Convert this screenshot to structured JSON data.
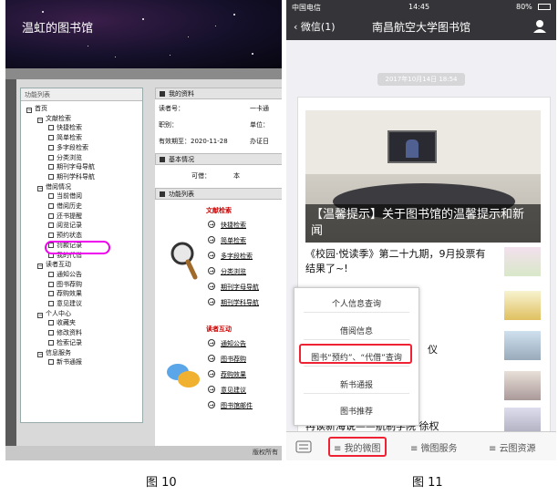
{
  "left": {
    "banner_title": "温虹的图书馆",
    "tree_header": "功能列表",
    "tree": [
      {
        "label": "首页",
        "level": 0
      },
      {
        "label": "文献检索",
        "level": 1
      },
      {
        "label": "快捷检索",
        "level": 2
      },
      {
        "label": "简单检索",
        "level": 2
      },
      {
        "label": "多字段检索",
        "level": 2
      },
      {
        "label": "分类浏览",
        "level": 2
      },
      {
        "label": "期刊字母导航",
        "level": 2
      },
      {
        "label": "期刊学科导航",
        "level": 2
      },
      {
        "label": "借阅情况",
        "level": 1
      },
      {
        "label": "当前借阅",
        "level": 2
      },
      {
        "label": "借阅历史",
        "level": 2
      },
      {
        "label": "还书提醒",
        "level": 2
      },
      {
        "label": "阅览记录",
        "level": 2
      },
      {
        "label": "预约状态",
        "level": 2
      },
      {
        "label": "罚款记录",
        "level": 2
      },
      {
        "label": "我的代借",
        "level": 2
      },
      {
        "label": "读者互动",
        "level": 1
      },
      {
        "label": "通知公告",
        "level": 2
      },
      {
        "label": "图书荐购",
        "level": 2
      },
      {
        "label": "荐购效果",
        "level": 2
      },
      {
        "label": "意见建议",
        "level": 2
      },
      {
        "label": "个人中心",
        "level": 1
      },
      {
        "label": "收藏夹",
        "level": 2
      },
      {
        "label": "修改资料",
        "level": 2
      },
      {
        "label": "检索记录",
        "level": 2
      },
      {
        "label": "信息服务",
        "level": 1
      },
      {
        "label": "新书通报",
        "level": 2
      }
    ],
    "info_header": "我的资料",
    "info_lines": [
      "读者号：",
      "一卡通",
      "职别：",
      "单位：",
      "有效期至：2020-11-28",
      "办证日"
    ],
    "basic_header": "基本情况",
    "basic_line": "可借：",
    "basic_value": "本",
    "func_header": "功能列表",
    "sec1_title": "文献检索",
    "sec1_links": [
      "快捷检索",
      "简单检索",
      "多字段检索",
      "分类浏览",
      "期刊字母导航",
      "期刊学科导航"
    ],
    "sec2_title": "读者互动",
    "sec2_links": [
      "通知公告",
      "图书荐购",
      "荐购效果",
      "意见建议",
      "图书馆邮件"
    ],
    "footer": "版权所有"
  },
  "right": {
    "status_carrier": "中国电信",
    "status_time": "14:45",
    "status_battery": "80%",
    "nav_back": "微信(1)",
    "nav_title": "南昌航空大学图书馆",
    "date_pill": "2017年10月14日 18:54",
    "card_caption": "【温馨提示】关于图书馆的温馨提示和新闻",
    "article2": "《校园·悦读季》第二十九期，9月投票有结果了~!",
    "partial_text_1": "仪",
    "partial_text_2": "冉读新海说——航制学院 徐权",
    "menu_items": [
      "个人信息查询",
      "借阅信息",
      "图书“预约”、“代借”查询",
      "新书通报",
      "图书推荐"
    ],
    "bottom_items": [
      "我的微图",
      "微图服务",
      "云图资源"
    ]
  },
  "captions": [
    "图 10",
    "图 11"
  ],
  "colors": {
    "highlight_magenta": "#ee00ee",
    "highlight_red": "#ee2233",
    "wechat_bar": "#353539"
  }
}
